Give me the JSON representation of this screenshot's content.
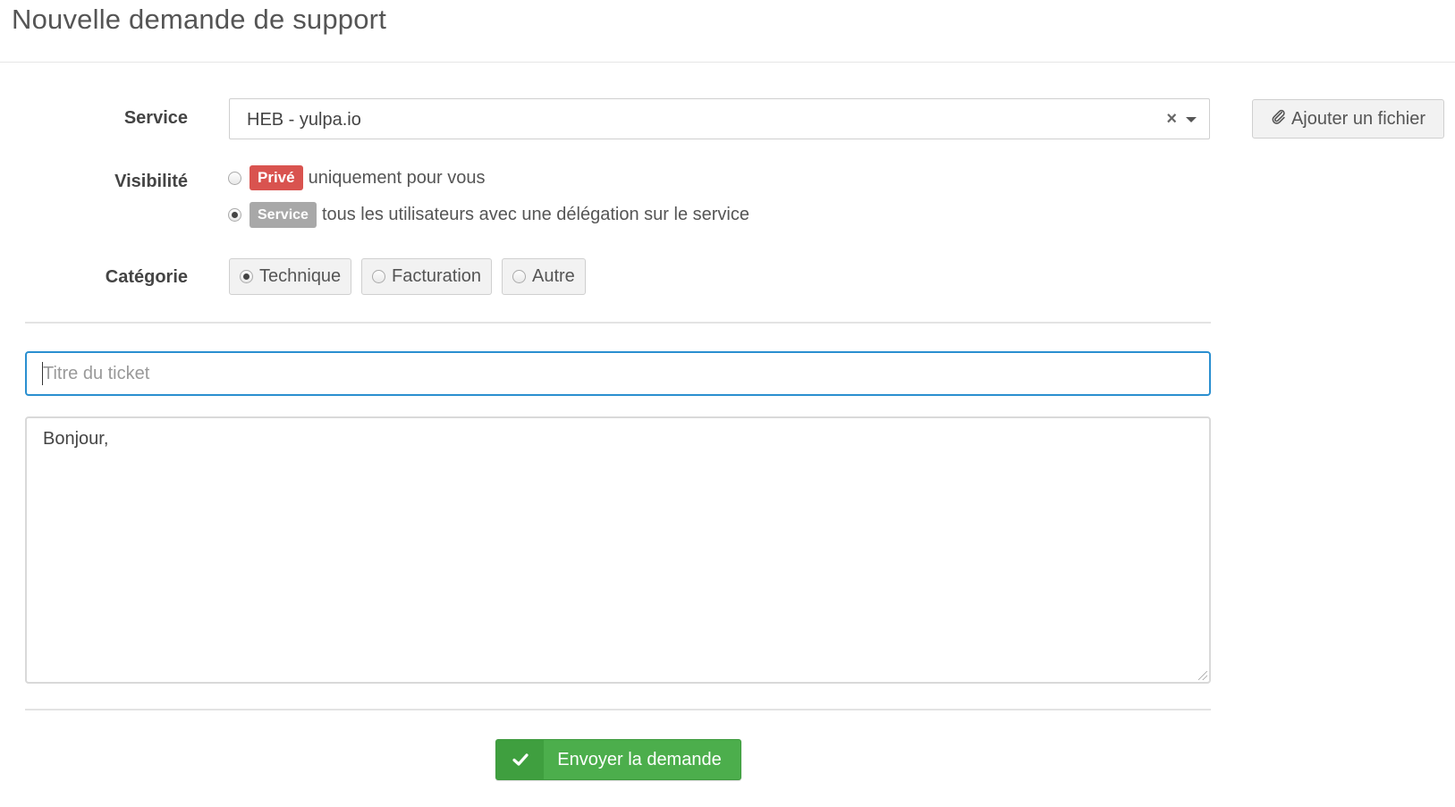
{
  "page": {
    "title": "Nouvelle demande de support"
  },
  "form": {
    "service": {
      "label": "Service",
      "value": "HEB - yulpa.io",
      "clear_glyph": "×"
    },
    "attach_button": {
      "label": "Ajouter un fichier",
      "icon": "paperclip-icon"
    },
    "visibility": {
      "label": "Visibilité",
      "options": [
        {
          "badge": "Privé",
          "text": "uniquement pour vous",
          "checked": false,
          "badge_color": "#d9534f"
        },
        {
          "badge": "Service",
          "text": "tous les utilisateurs avec une délégation sur le service",
          "checked": true,
          "badge_color": "#a8a8a8"
        }
      ]
    },
    "category": {
      "label": "Catégorie",
      "options": [
        {
          "label": "Technique",
          "checked": true
        },
        {
          "label": "Facturation",
          "checked": false
        },
        {
          "label": "Autre",
          "checked": false
        }
      ]
    },
    "ticket_title": {
      "placeholder": "Titre du ticket",
      "value": ""
    },
    "message": {
      "value": "Bonjour,"
    },
    "submit": {
      "label": "Envoyer la demande",
      "icon": "check-icon",
      "color": "#4cae4c"
    }
  }
}
